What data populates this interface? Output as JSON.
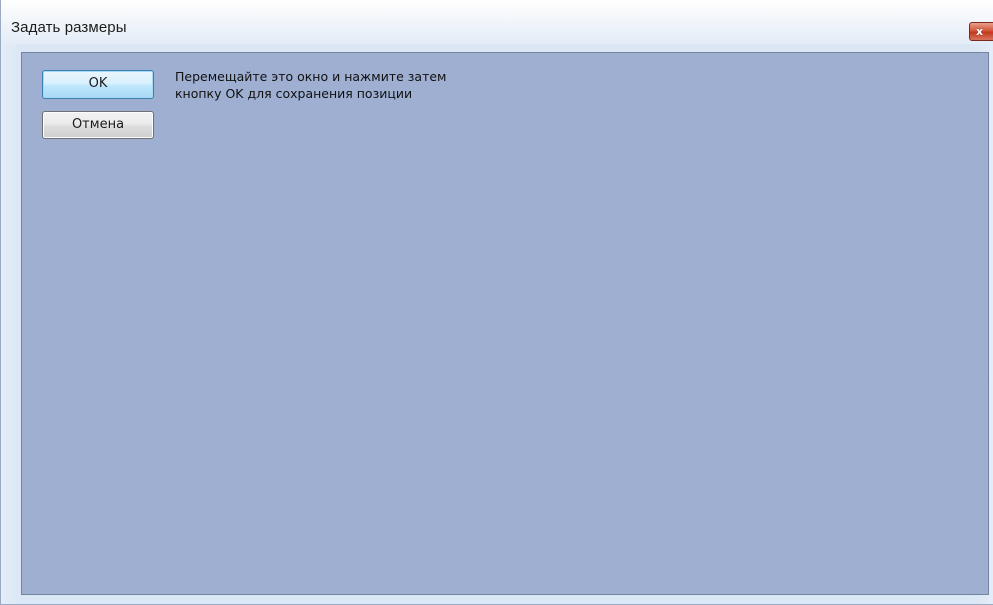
{
  "window": {
    "title": "Задать размеры",
    "close_glyph": "x",
    "close_icon": "close-icon"
  },
  "dialog": {
    "ok_label": "OK",
    "cancel_label": "Отмена",
    "message_line1": "Перемещайте это окно и нажмите затем",
    "message_line2": "кнопку OK для сохранения позиции"
  },
  "colors": {
    "client_background": "#9eafd2",
    "window_frame": "#dbe7f5",
    "close_button": "#c23a20",
    "ok_button_border": "#3c7fb1"
  }
}
